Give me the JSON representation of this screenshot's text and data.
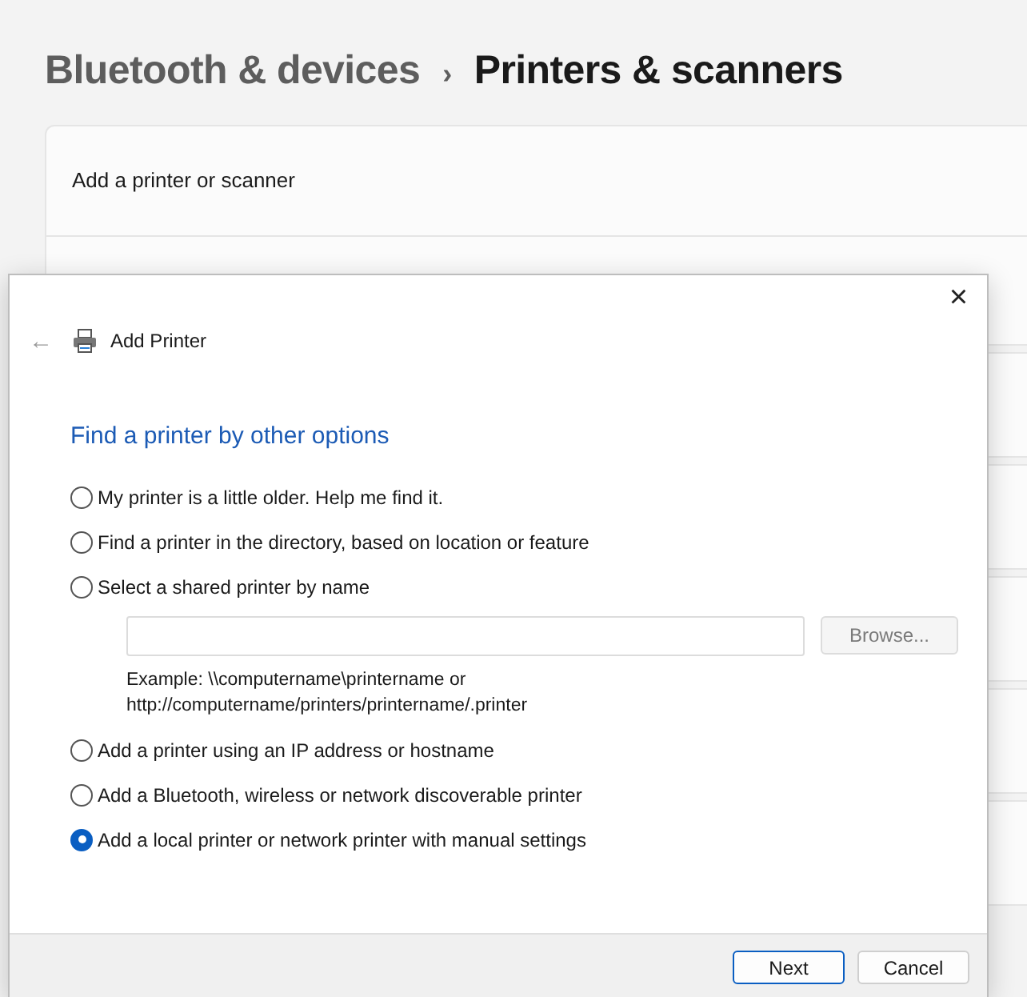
{
  "breadcrumb": {
    "parent": "Bluetooth & devices",
    "separator": "›",
    "current": "Printers & scanners"
  },
  "settings_rows": [
    {
      "label": "Add a printer or scanner"
    }
  ],
  "dialog": {
    "close": "×",
    "back": "←",
    "title": "Add Printer",
    "heading": "Find a printer by other options",
    "options": [
      {
        "label": "My printer is a little older. Help me find it.",
        "selected": false
      },
      {
        "label": "Find a printer in the directory, based on location or feature",
        "selected": false
      },
      {
        "label": "Select a shared printer by name",
        "selected": false,
        "field": {
          "button": "Browse...",
          "button_disabled": true,
          "example": "Example: \\\\computername\\printername or\nhttp://computername/printers/printername/.printer"
        }
      },
      {
        "label": "Add a printer using an IP address or hostname",
        "selected": false
      },
      {
        "label": "Add a Bluetooth, wireless or network discoverable printer",
        "selected": false
      },
      {
        "label": "Add a local printer or network printer with manual settings",
        "selected": true
      }
    ],
    "buttons": [
      {
        "label": "Next",
        "default": true
      },
      {
        "label": "Cancel",
        "default": false
      }
    ]
  }
}
